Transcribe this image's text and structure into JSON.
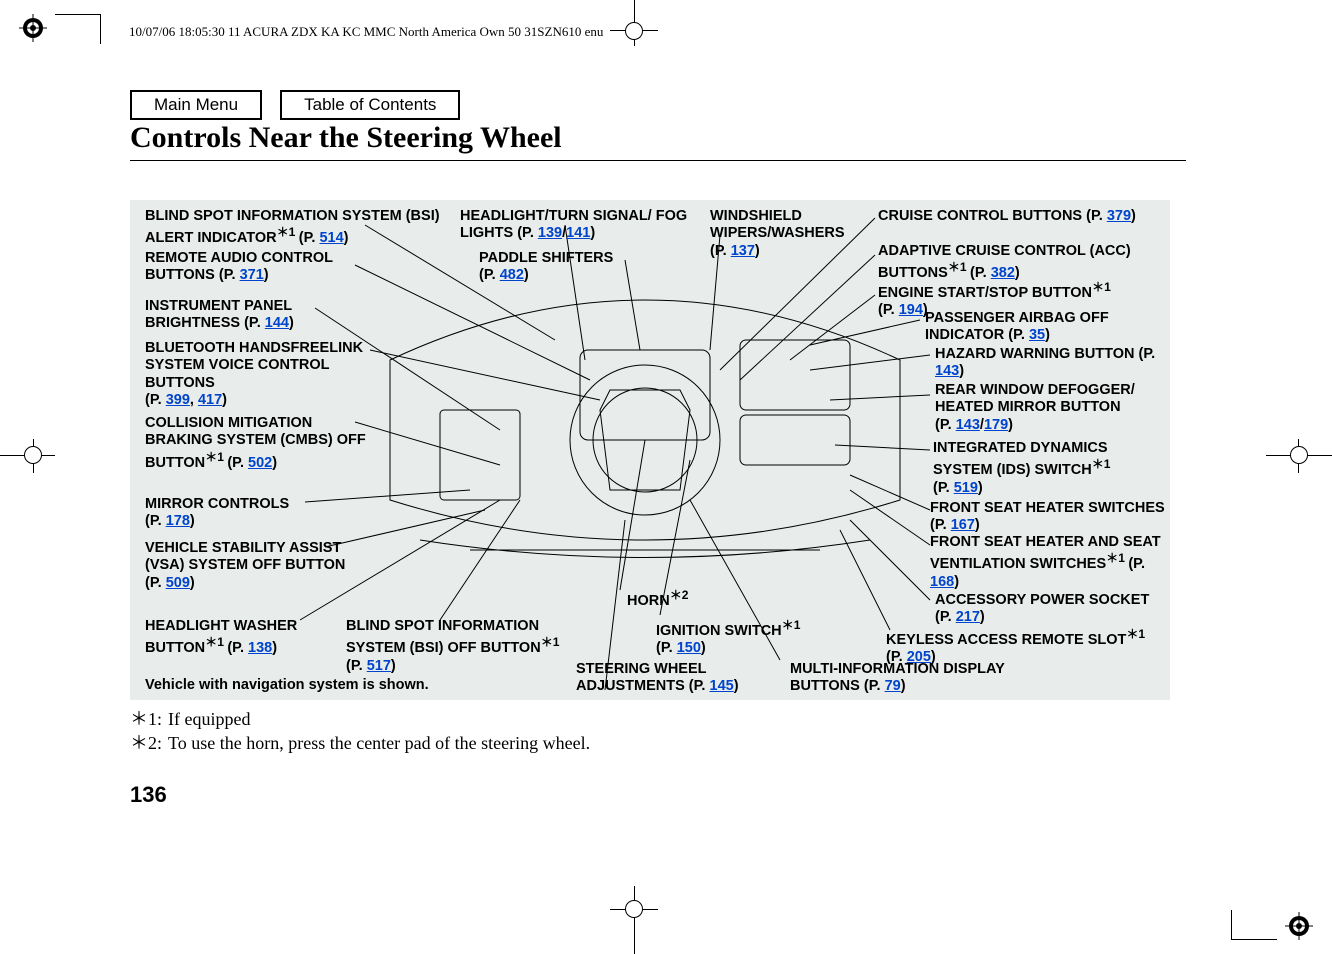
{
  "meta": {
    "header": "10/07/06 18:05:30   11 ACURA ZDX KA KC MMC North America Own 50 31SZN610 enu"
  },
  "nav": {
    "main_menu": "Main Menu",
    "toc": "Table of Contents"
  },
  "title": "Controls Near the Steering Wheel",
  "callouts": {
    "bsi_alert": {
      "text": "BLIND SPOT INFORMATION SYSTEM (BSI) ALERT INDICATOR",
      "sup": "＊1 ",
      "page_prefix": "(P. ",
      "page": "514",
      "close": ")"
    },
    "remote_audio": {
      "text": "REMOTE AUDIO CONTROL BUTTONS ",
      "page_prefix": "(P. ",
      "page": "371",
      "close": ")"
    },
    "instrument": {
      "text": "INSTRUMENT PANEL BRIGHTNESS ",
      "page_prefix": "(P. ",
      "page": "144",
      "close": ")"
    },
    "bluetooth": {
      "text": "BLUETOOTH HANDSFREELINK SYSTEM VOICE CONTROL BUTTONS",
      "page_prefix": "(P. ",
      "page1": "399",
      "sep": ", ",
      "page2": "417",
      "close": ")"
    },
    "cmbs": {
      "text": "COLLISION MITIGATION BRAKING SYSTEM (CMBS) OFF BUTTON",
      "sup": "＊1 ",
      "page_prefix": "(P. ",
      "page": "502",
      "close": ")"
    },
    "mirror": {
      "text": "MIRROR CONTROLS",
      "page_prefix": "(P. ",
      "page": "178",
      "close": ")"
    },
    "vsa": {
      "text": "VEHICLE STABILITY ASSIST (VSA) SYSTEM OFF BUTTON ",
      "page_prefix": "(P. ",
      "page": "509",
      "close": ")"
    },
    "headlight_washer": {
      "text": "HEADLIGHT WASHER BUTTON",
      "sup": "＊1 ",
      "page_prefix": "(P. ",
      "page": "138",
      "close": ")"
    },
    "bsi_off": {
      "text": "BLIND SPOT INFORMATION SYSTEM (BSI) OFF BUTTON",
      "sup": "＊1",
      "page_prefix": "(P. ",
      "page": "517",
      "close": ")"
    },
    "headlight_turn": {
      "text": "HEADLIGHT/TURN SIGNAL/ FOG LIGHTS ",
      "page_prefix": "(P. ",
      "page1": "139",
      "sep": "/",
      "page2": "141",
      "close": ")"
    },
    "paddle": {
      "text": "PADDLE SHIFTERS",
      "page_prefix": "(P. ",
      "page": "482",
      "close": ")"
    },
    "windshield": {
      "text": "WINDSHIELD WIPERS/WASHERS",
      "page_prefix": "(P. ",
      "page": "137",
      "close": ")"
    },
    "cruise": {
      "text": "CRUISE CONTROL BUTTONS ",
      "page_prefix": "(P. ",
      "page": "379",
      "close": ")"
    },
    "acc": {
      "text": "ADAPTIVE CRUISE CONTROL (ACC) BUTTONS",
      "sup": "＊1 ",
      "page_prefix": "(P. ",
      "page": "382",
      "close": ")"
    },
    "engine_start": {
      "text": "ENGINE START/STOP BUTTON",
      "sup": "＊1",
      "page_prefix": "(P. ",
      "page": "194",
      "close": ")"
    },
    "airbag": {
      "text": "PASSENGER AIRBAG OFF INDICATOR ",
      "page_prefix": "(P. ",
      "page": "35",
      "close": ")"
    },
    "hazard": {
      "text": "HAZARD WARNING BUTTON ",
      "page_prefix": "(P. ",
      "page": "143",
      "close": ")"
    },
    "defogger": {
      "text": "REAR WINDOW DEFOGGER/ HEATED MIRROR BUTTON",
      "page_prefix": "(P. ",
      "page1": "143",
      "sep": "/",
      "page2": "179",
      "close": ")"
    },
    "ids": {
      "text": "INTEGRATED DYNAMICS SYSTEM (IDS) SWITCH",
      "sup": "＊1",
      "page_prefix": "(P. ",
      "page": "519",
      "close": ")"
    },
    "seat_heater": {
      "text": "FRONT SEAT HEATER SWITCHES ",
      "page_prefix": "(P. ",
      "page": "167",
      "close": ")"
    },
    "seat_vent": {
      "text": "FRONT SEAT HEATER AND SEAT VENTILATION SWITCHES",
      "sup": "＊1 ",
      "page_prefix": "(P. ",
      "page": "168",
      "close": ")"
    },
    "accessory": {
      "text": "ACCESSORY POWER SOCKET ",
      "page_prefix": "(P. ",
      "page": "217",
      "close": ")"
    },
    "keyless": {
      "text": "KEYLESS ACCESS REMOTE SLOT",
      "sup": "＊1 ",
      "page_prefix": "(P. ",
      "page": "205",
      "close": ")"
    },
    "mid": {
      "text": "MULTI-INFORMATION DISPLAY BUTTONS ",
      "page_prefix": "(P. ",
      "page": "79",
      "close": ")"
    },
    "horn": {
      "text": "HORN",
      "sup": "＊2"
    },
    "ignition": {
      "text": "IGNITION SWITCH",
      "sup": "＊1",
      "page_prefix": "(P. ",
      "page": "150",
      "close": ")"
    },
    "steering_adj": {
      "text": "STEERING WHEEL ADJUSTMENTS ",
      "page_prefix": "(P. ",
      "page": "145",
      "close": ")"
    }
  },
  "note": "Vehicle with navigation system is shown.",
  "footnotes": {
    "f1_sym": "＊1:",
    "f1_text": "If equipped",
    "f2_sym": "＊2:",
    "f2_text": "To use the horn, press the center pad of the steering wheel."
  },
  "page_number": "136"
}
